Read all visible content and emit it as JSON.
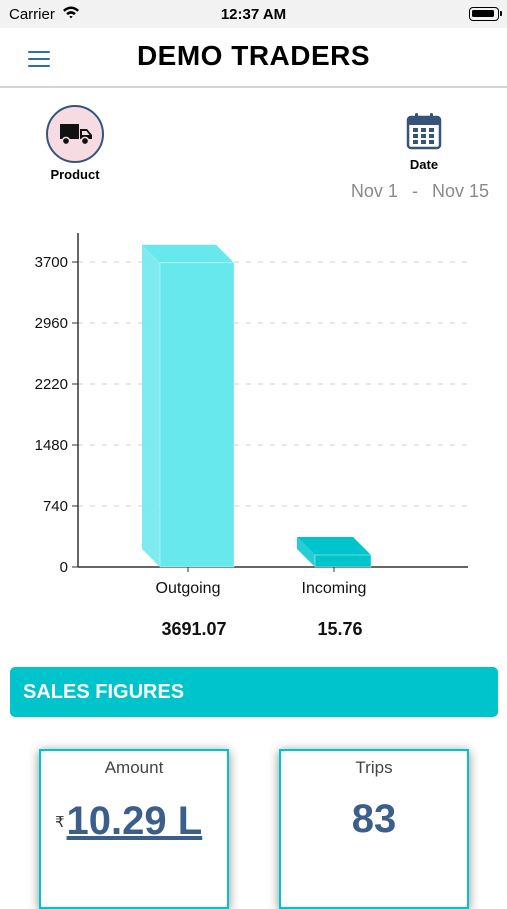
{
  "status_bar": {
    "carrier": "Carrier",
    "time": "12:37 AM"
  },
  "header": {
    "title": "DEMO TRADERS"
  },
  "filters": {
    "product_label": "Product",
    "date_label": "Date",
    "date_from": "Nov 1",
    "date_separator": "-",
    "date_to": "Nov 15"
  },
  "chart_data": {
    "type": "bar",
    "categories": [
      "Outgoing",
      "Incoming"
    ],
    "values": [
      3691.07,
      15.76
    ],
    "value_labels": [
      "3691.07",
      "15.76"
    ],
    "yticks": [
      0,
      740,
      1480,
      2220,
      2960,
      3700
    ],
    "ylim": [
      0,
      4000
    ],
    "grid": "horizontal-dashed",
    "colors": [
      "#66e8ec",
      "#00c4cc"
    ]
  },
  "sales": {
    "header": "SALES FIGURES",
    "amount_title": "Amount",
    "currency_symbol": "₹",
    "amount_value": "10.29 L",
    "trips_title": "Trips",
    "trips_value": "83"
  },
  "colors": {
    "accent": "#00c4cc",
    "value_text": "#3b5f8a",
    "nav_icon": "#2c6eaf"
  }
}
